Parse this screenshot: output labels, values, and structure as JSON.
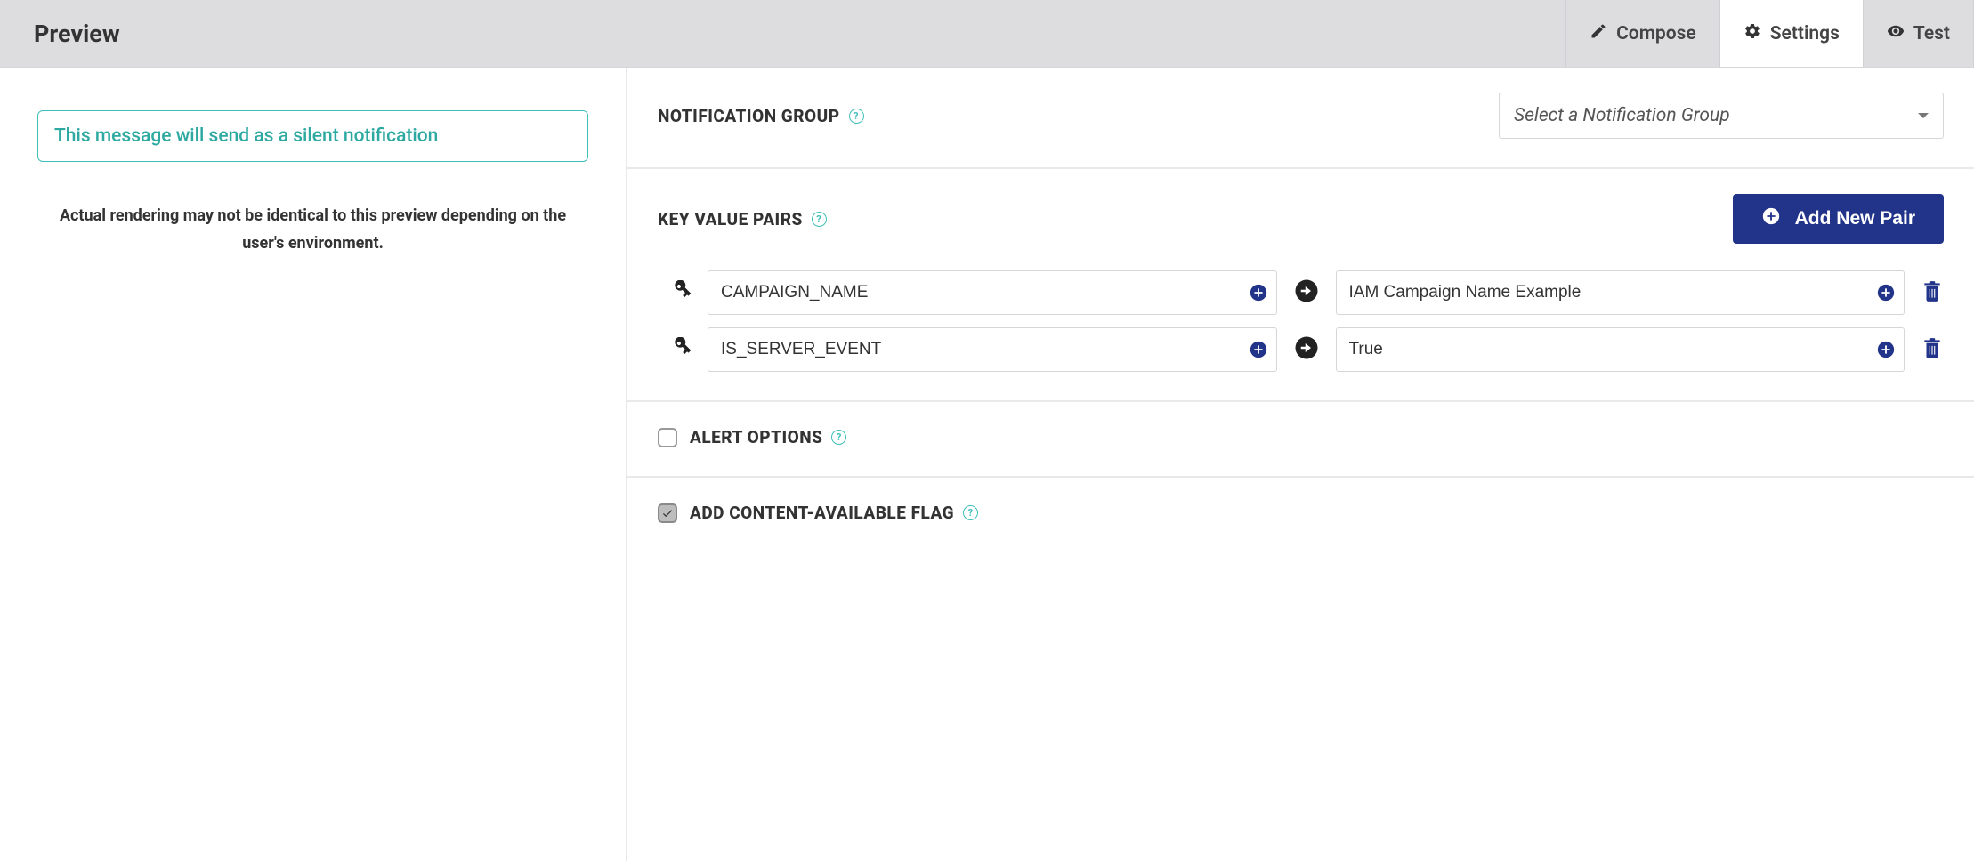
{
  "header": {
    "title": "Preview",
    "tabs": {
      "compose": "Compose",
      "settings": "Settings",
      "test": "Test"
    }
  },
  "preview": {
    "silent_message": "This message will send as a silent notification",
    "render_note": "Actual rendering may not be identical to this preview depending on the user's environment."
  },
  "settings": {
    "notification_group": {
      "label": "NOTIFICATION GROUP",
      "placeholder": "Select a Notification Group",
      "selected": ""
    },
    "key_value_pairs": {
      "label": "KEY VALUE PAIRS",
      "add_button": "Add New Pair",
      "pairs": [
        {
          "key": "CAMPAIGN_NAME",
          "value": "IAM Campaign Name Example"
        },
        {
          "key": "IS_SERVER_EVENT",
          "value": "True"
        }
      ]
    },
    "alert_options": {
      "label": "ALERT OPTIONS",
      "checked": false
    },
    "content_available": {
      "label": "ADD CONTENT-AVAILABLE FLAG",
      "checked": true
    }
  },
  "help_glyph": "?"
}
